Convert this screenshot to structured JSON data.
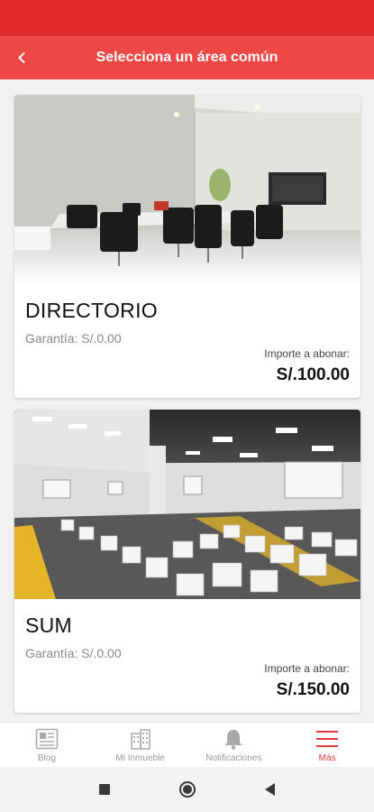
{
  "header": {
    "title": "Selecciona un área común"
  },
  "areas": [
    {
      "name": "DIRECTORIO",
      "guarantee": "Garantía: S/.0.00",
      "amount_label": "Importe a abonar:",
      "amount": "S/.100.00"
    },
    {
      "name": "SUM",
      "guarantee": "Garantía: S/.0.00",
      "amount_label": "Importe a abonar:",
      "amount": "S/.150.00"
    }
  ],
  "bottom_nav": [
    {
      "label": "Blog",
      "icon": "newspaper-icon"
    },
    {
      "label": "Mi Inmueble",
      "icon": "buildings-icon"
    },
    {
      "label": "Notificaciones",
      "icon": "bell-icon"
    },
    {
      "label": "Más",
      "icon": "menu-icon",
      "active": true
    }
  ],
  "colors": {
    "status_bar": "#e12a2a",
    "app_bar": "#ef4646",
    "active_nav": "#e63b3b"
  }
}
